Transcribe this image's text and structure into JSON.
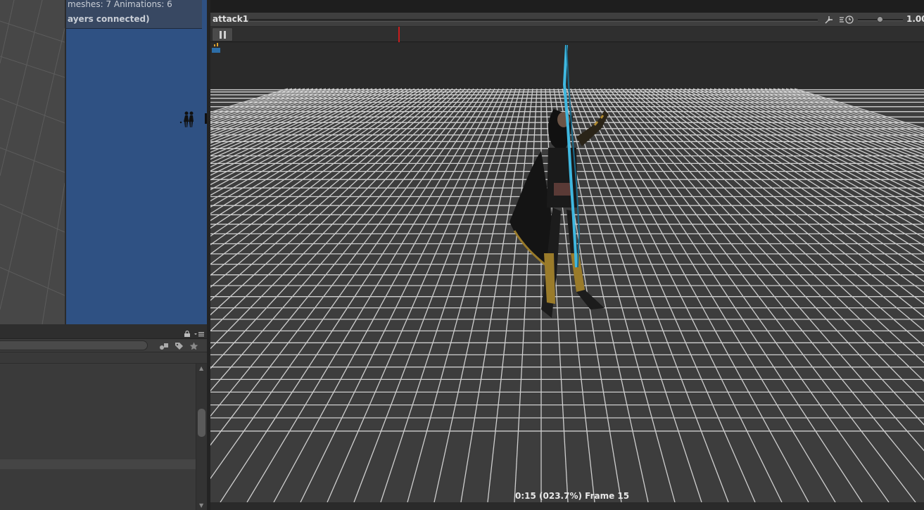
{
  "game_view": {
    "stats_line1": "meshes: 7  Animations: 6",
    "stats_line2": "ayers connected)"
  },
  "project_panel": {
    "search_placeholder": "",
    "icons": [
      "lock-icon",
      "menu-icon",
      "filter-by-type-icon",
      "filter-by-label-icon",
      "favorite-star-icon"
    ]
  },
  "preview": {
    "clip_name": "attack1",
    "speed_value": "1.00",
    "frame_info": "0:15 (023.7%) Frame 15",
    "playhead_fraction": 0.263
  },
  "colors": {
    "game_view_bg": "#2f5183",
    "playhead": "#c81d1d",
    "editor_dark": "#383838"
  }
}
